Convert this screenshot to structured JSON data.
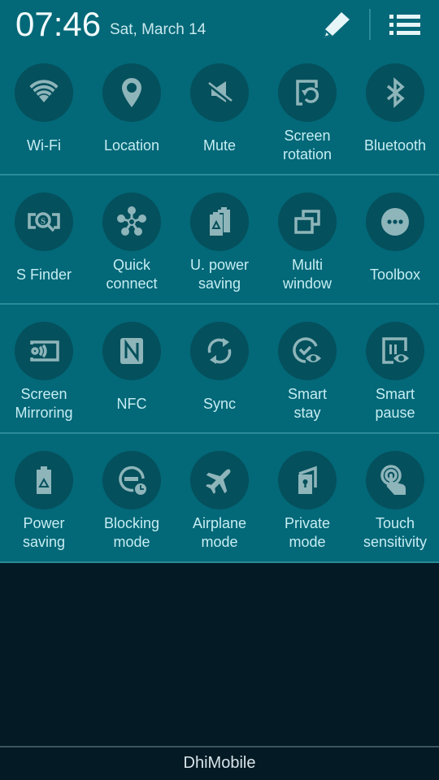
{
  "header": {
    "time": "07:46",
    "date": "Sat, March 14",
    "edit_icon": "pencil-icon",
    "list_icon": "list-icon"
  },
  "colors": {
    "panel_bg": "#036878",
    "tile_circle": "#04505c",
    "icon": "#8eb5ba",
    "label_text": "#c6edf2",
    "screen_bg": "#041a24"
  },
  "tiles": [
    [
      {
        "label": "Wi-Fi",
        "icon": "wifi-icon"
      },
      {
        "label": "Location",
        "icon": "location-pin-icon"
      },
      {
        "label": "Mute",
        "icon": "mute-icon"
      },
      {
        "label": "Screen rotation",
        "line1": "Screen",
        "line2": "rotation",
        "icon": "screen-rotation-icon"
      },
      {
        "label": "Bluetooth",
        "icon": "bluetooth-icon"
      }
    ],
    [
      {
        "label": "S Finder",
        "icon": "s-finder-icon"
      },
      {
        "label": "Quick connect",
        "line1": "Quick",
        "line2": "connect",
        "icon": "quick-connect-icon"
      },
      {
        "label": "U. power saving",
        "line1": "U. power",
        "line2": "saving",
        "icon": "ultra-power-saving-icon"
      },
      {
        "label": "Multi window",
        "line1": "Multi",
        "line2": "window",
        "icon": "multi-window-icon"
      },
      {
        "label": "Toolbox",
        "icon": "toolbox-icon"
      }
    ],
    [
      {
        "label": "Screen Mirroring",
        "line1": "Screen",
        "line2": "Mirroring",
        "icon": "screen-mirroring-icon"
      },
      {
        "label": "NFC",
        "icon": "nfc-icon"
      },
      {
        "label": "Sync",
        "icon": "sync-icon"
      },
      {
        "label": "Smart stay",
        "line1": "Smart",
        "line2": "stay",
        "icon": "smart-stay-icon"
      },
      {
        "label": "Smart pause",
        "line1": "Smart",
        "line2": "pause",
        "icon": "smart-pause-icon"
      }
    ],
    [
      {
        "label": "Power saving",
        "line1": "Power",
        "line2": "saving",
        "icon": "power-saving-icon"
      },
      {
        "label": "Blocking mode",
        "line1": "Blocking",
        "line2": "mode",
        "icon": "blocking-mode-icon"
      },
      {
        "label": "Airplane mode",
        "line1": "Airplane",
        "line2": "mode",
        "icon": "airplane-icon"
      },
      {
        "label": "Private mode",
        "line1": "Private",
        "line2": "mode",
        "icon": "private-mode-icon"
      },
      {
        "label": "Touch sensitivity",
        "line1": "Touch",
        "line2": "sensitivity",
        "icon": "touch-sensitivity-icon"
      }
    ]
  ],
  "footer": {
    "carrier": "DhiMobile"
  }
}
